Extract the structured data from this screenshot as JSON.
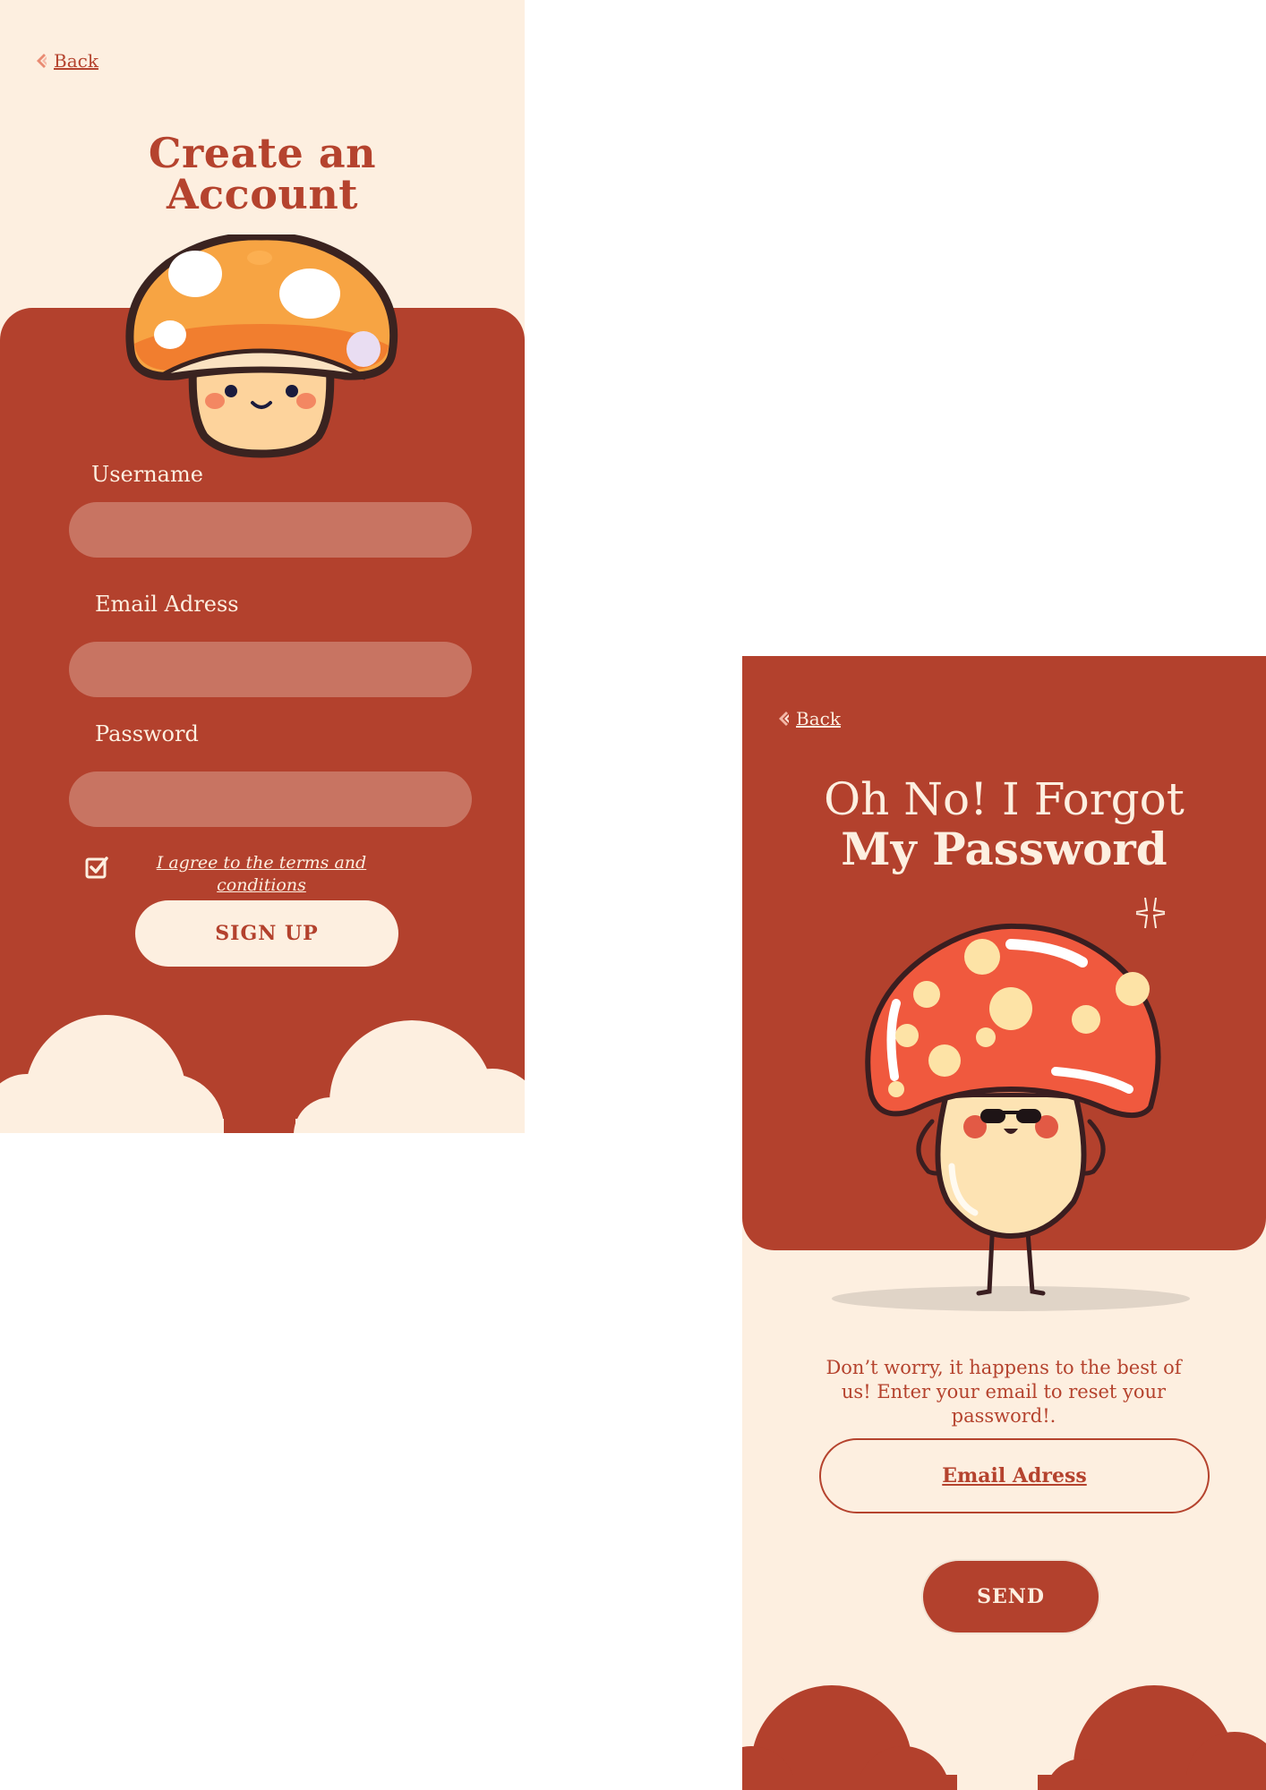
{
  "colors": {
    "brick_red": "#b3412d",
    "cream": "#fdefe0",
    "input_fill": "#c87462"
  },
  "signup": {
    "back_label": "Back",
    "back_icon": "chevron-left-icon",
    "title_line1": "Create an",
    "title_line2": "Account",
    "username_label": "Username",
    "username_value": "",
    "email_label": "Email Adress",
    "email_value": "",
    "password_label": "Password",
    "password_value": "",
    "terms_checked": true,
    "terms_line1": "I agree to the terms and",
    "terms_line2": "conditions",
    "signup_button": "SIGN UP"
  },
  "forgot": {
    "back_label": "Back",
    "back_icon": "chevron-left-icon",
    "title_line1": "Oh No! I Forgot",
    "title_line2": "My Password",
    "description": "Don’t worry, it happens to the best of us! Enter your email to reset your password!.",
    "email_button": "Email Adress",
    "send_button": "SEND"
  }
}
